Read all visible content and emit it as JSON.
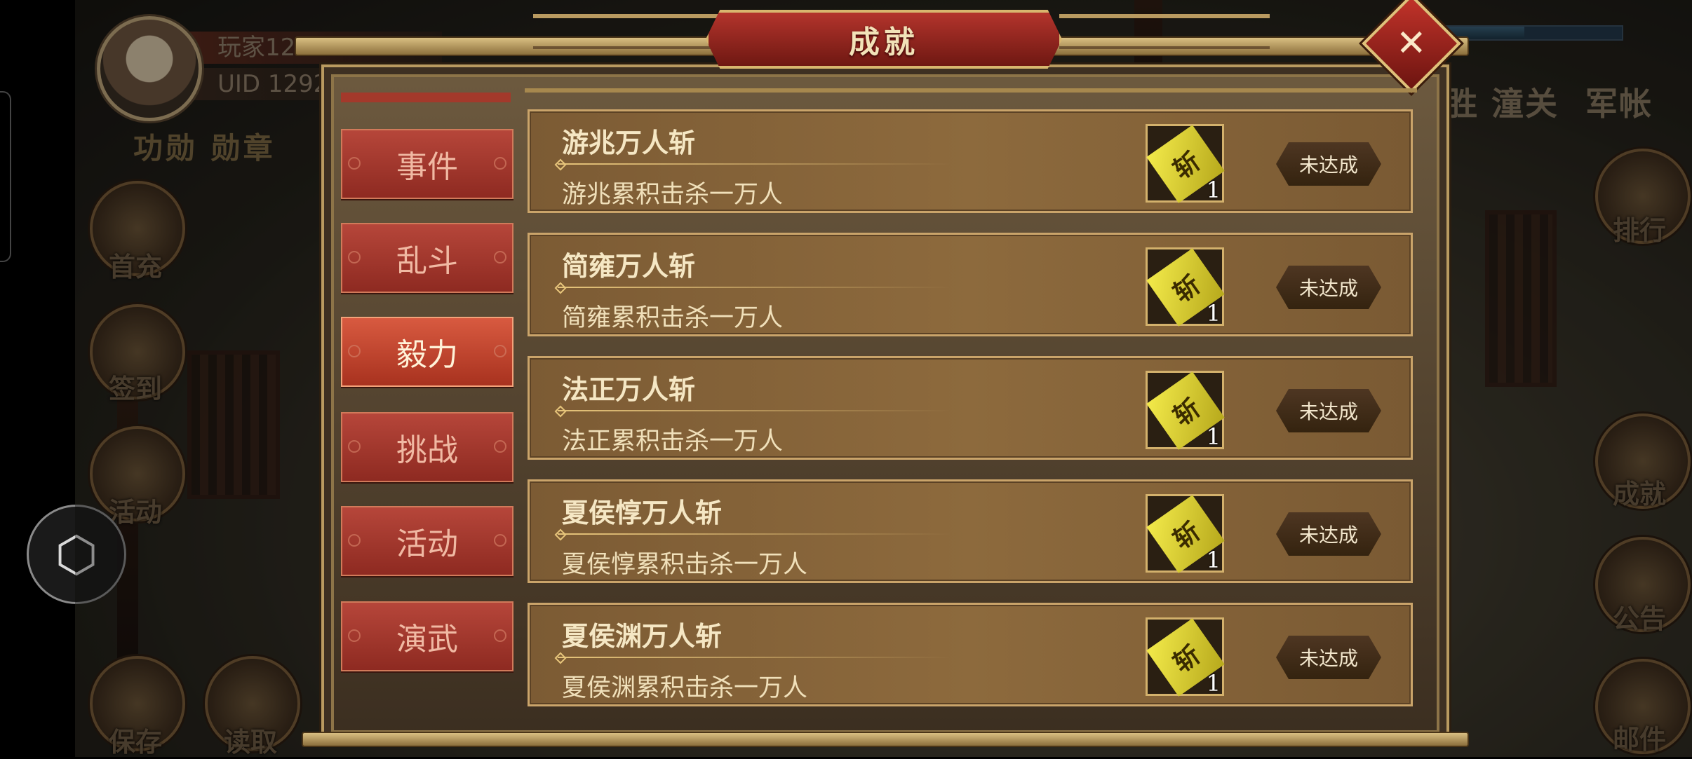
{
  "player": {
    "name": "玩家12",
    "uid": "UID  1292",
    "merit_label": "功勋  勋章"
  },
  "side_buttons_left": [
    {
      "label": "首充"
    },
    {
      "label": "签到"
    },
    {
      "label": "活动"
    },
    {
      "label": "保存"
    },
    {
      "label": "读取"
    }
  ],
  "side_buttons_right": [
    {
      "label": "排行"
    },
    {
      "label": "成就"
    },
    {
      "label": "公告"
    },
    {
      "label": "邮件"
    }
  ],
  "top_right": {
    "location": "胜 潼关",
    "camp": "军帐"
  },
  "hp_fraction": 0.55,
  "modal": {
    "title": "成就",
    "close_icon": "✕",
    "tabs": [
      {
        "label": "事件",
        "active": false
      },
      {
        "label": "乱斗",
        "active": false
      },
      {
        "label": "毅力",
        "active": true
      },
      {
        "label": "挑战",
        "active": false
      },
      {
        "label": "活动",
        "active": false
      },
      {
        "label": "演武",
        "active": false
      }
    ],
    "achievements": [
      {
        "name": "游兆万人斩",
        "desc": "游兆累积击杀一万人",
        "reward_icon": "斩",
        "reward_qty": "1",
        "status": "未达成"
      },
      {
        "name": "简雍万人斩",
        "desc": "简雍累积击杀一万人",
        "reward_icon": "斩",
        "reward_qty": "1",
        "status": "未达成"
      },
      {
        "name": "法正万人斩",
        "desc": "法正累积击杀一万人",
        "reward_icon": "斩",
        "reward_qty": "1",
        "status": "未达成"
      },
      {
        "name": "夏侯惇万人斩",
        "desc": "夏侯惇累积击杀一万人",
        "reward_icon": "斩",
        "reward_qty": "1",
        "status": "未达成"
      },
      {
        "name": "夏侯渊万人斩",
        "desc": "夏侯渊累积击杀一万人",
        "reward_icon": "斩",
        "reward_qty": "1",
        "status": "未达成"
      }
    ]
  },
  "cube_icon": "⬡"
}
